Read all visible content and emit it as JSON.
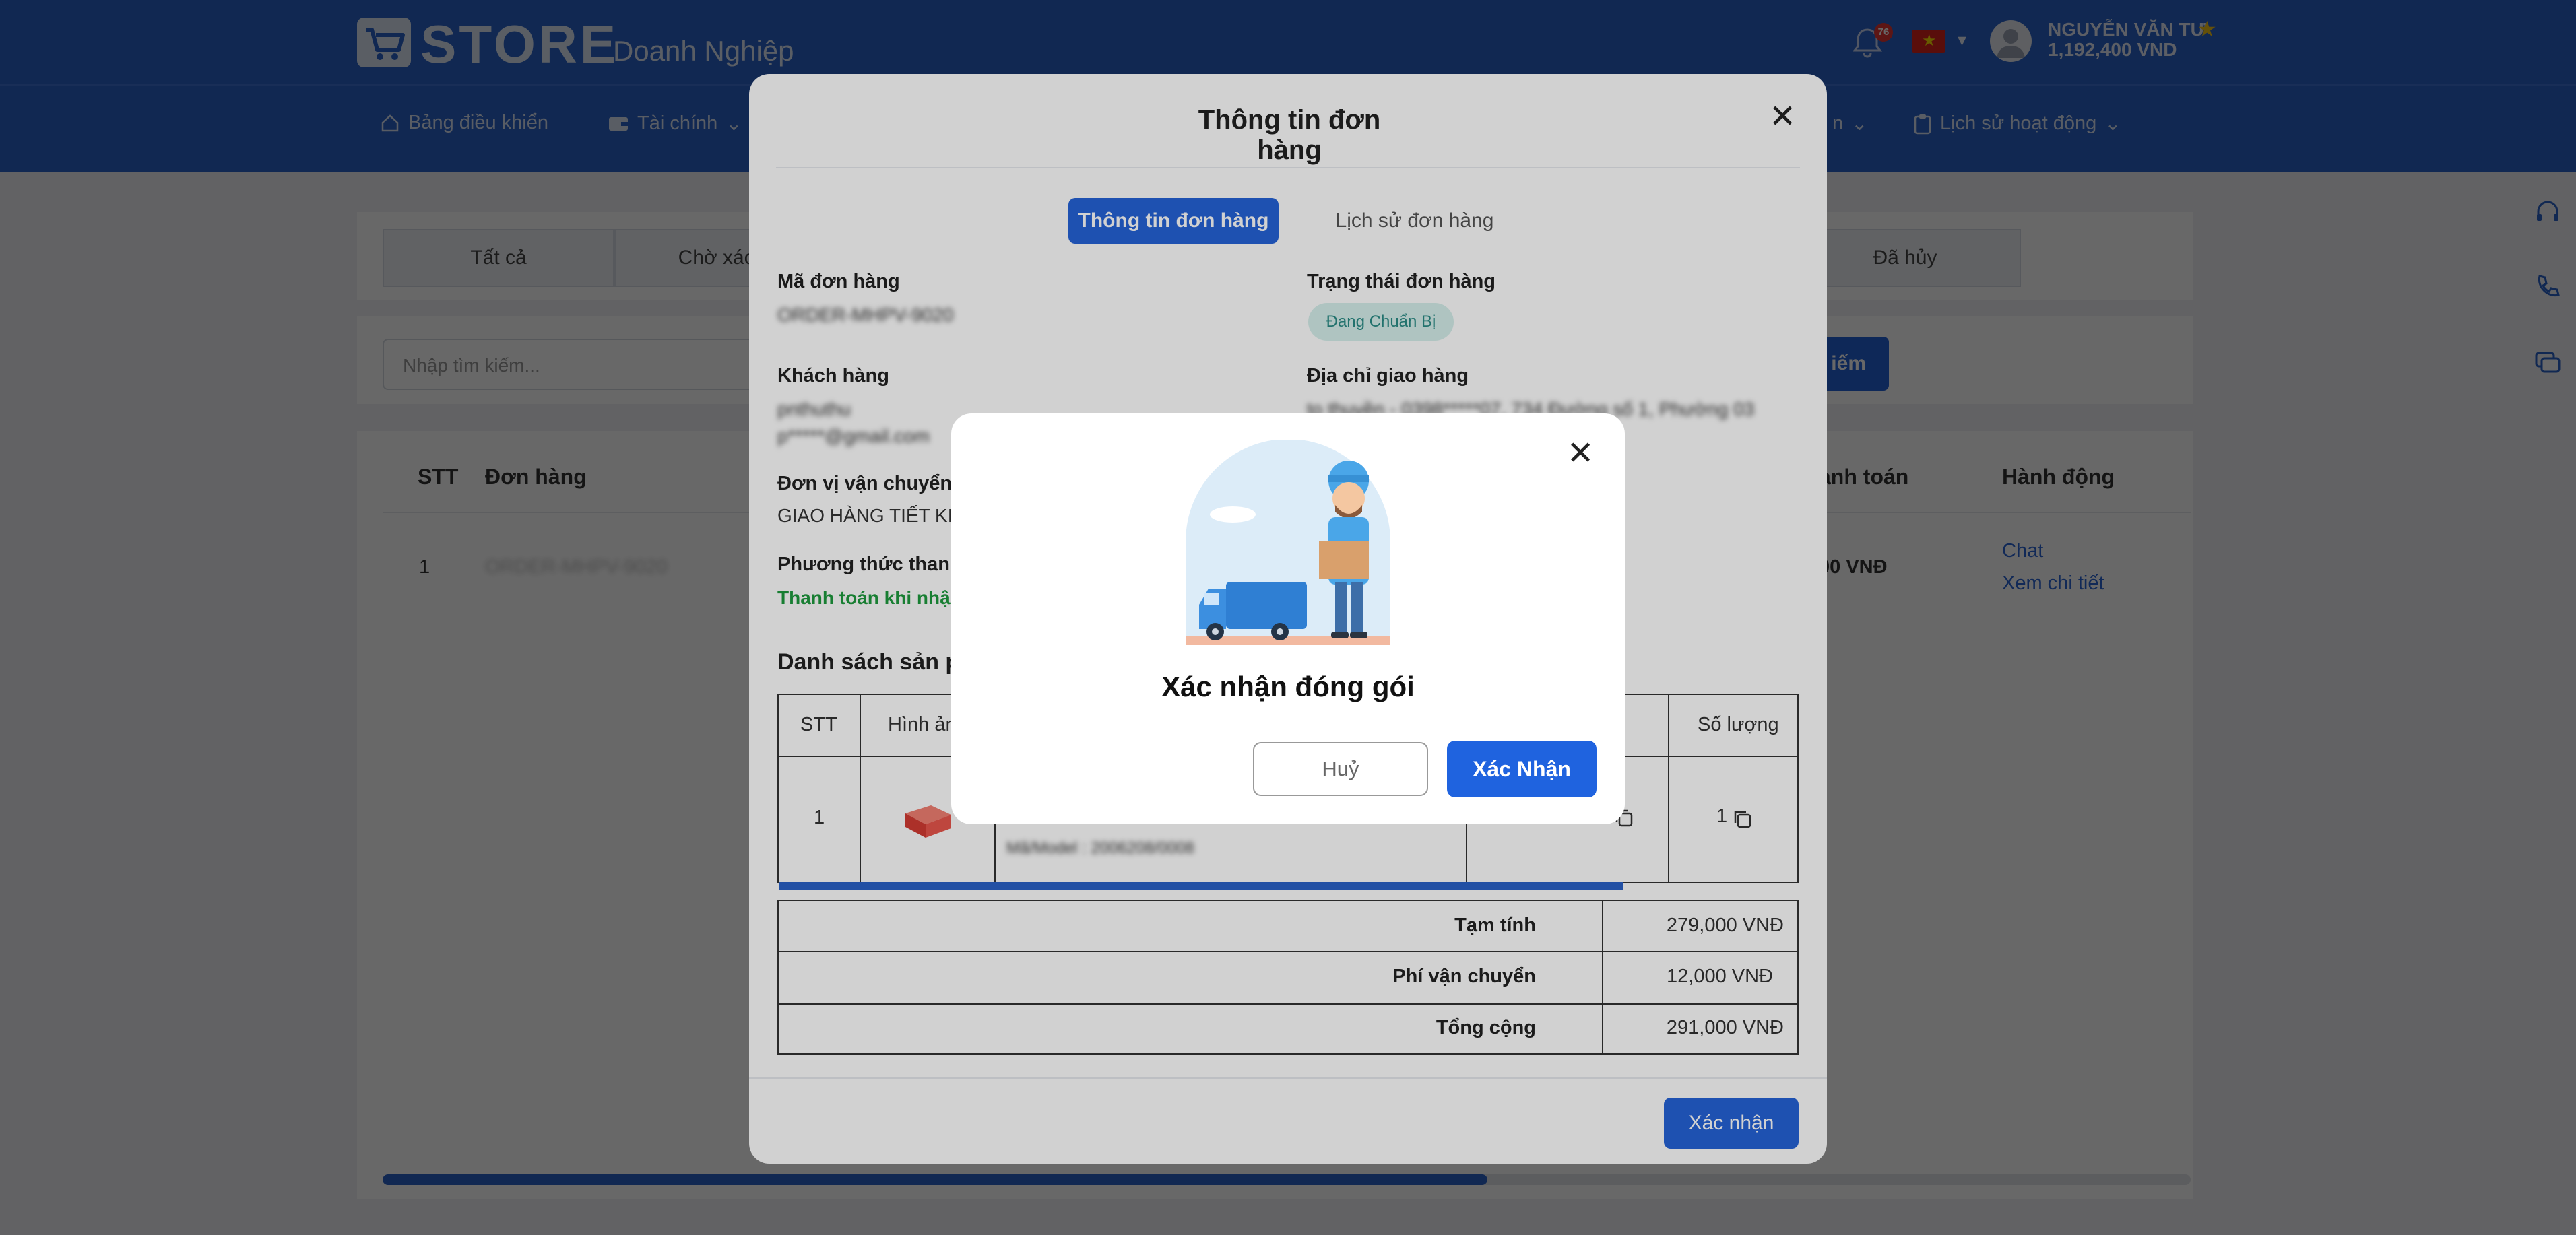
{
  "header": {
    "brand": "STORE",
    "brand_sub": "Doanh Nghiệp",
    "notification_count": "76",
    "user_name": "NGUYỄN VĂN TƯ",
    "user_balance": "1,192,400 VND"
  },
  "nav": {
    "items": [
      {
        "label": "Bảng điều khiển",
        "icon": "home-icon"
      },
      {
        "label": "Tài chính",
        "icon": "wallet-icon"
      },
      {
        "label": "n",
        "icon": "chevron-down-icon"
      },
      {
        "label": "Lịch sử hoạt động",
        "icon": "clipboard-icon"
      }
    ]
  },
  "page": {
    "tabs": [
      "Tất cả",
      "Chờ xác nh",
      "Đã hủy"
    ],
    "search_placeholder": "Nhập tìm kiếm...",
    "search_button": "iếm",
    "table_headers": {
      "stt": "STT",
      "order": "Đơn hàng",
      "payment": "anh toán",
      "action": "Hành động"
    },
    "row": {
      "stt": "1",
      "order_code": "ORDER-MHPV-9020",
      "payment": "00 VNĐ",
      "chat": "Chat",
      "detail": "Xem chi tiết"
    }
  },
  "order_modal": {
    "title": "Thông tin đơn hàng",
    "tab_info": "Thông tin đơn hàng",
    "tab_history": "Lịch sử đơn hàng",
    "order_code_label": "Mã đơn hàng",
    "order_code_value": "ORDER-MHPV-9020",
    "status_label": "Trạng thái đơn hàng",
    "status_value": "Đang Chuẩn Bị",
    "customer_label": "Khách hàng",
    "customer_name": "pnthuthu",
    "customer_email": "p*****@gmail.com",
    "address_label": "Địa chỉ giao hàng",
    "address_value": "to thuyền - 0398*****07, 734 Đường số 1, Phường 03",
    "carrier_label": "Đơn vị vận chuyển",
    "carrier_value": "GIAO HÀNG TIẾT KIỆ",
    "payment_label": "Phương thức thanh t",
    "payment_value": "Thanh toán khi nhận",
    "product_list_title": "Danh sách sản ph",
    "product_headers": {
      "stt": "STT",
      "image": "Hình ản",
      "qty": "Số lượng"
    },
    "product_row": {
      "stt": "1",
      "sku": "Mã/Model : 2006208/0008",
      "qty": "1"
    },
    "subtotal_label": "Tạm tính",
    "subtotal_value": "279,000 VNĐ",
    "shipping_label": "Phí vận chuyển",
    "shipping_value": "12,000 VNĐ",
    "total_label": "Tổng cộng",
    "total_value": "291,000 VNĐ",
    "confirm_button": "Xác nhận"
  },
  "dialog": {
    "title": "Xác nhận đóng gói",
    "cancel": "Huỷ",
    "confirm": "Xác Nhận",
    "illustration": "delivery-man-with-truck"
  }
}
